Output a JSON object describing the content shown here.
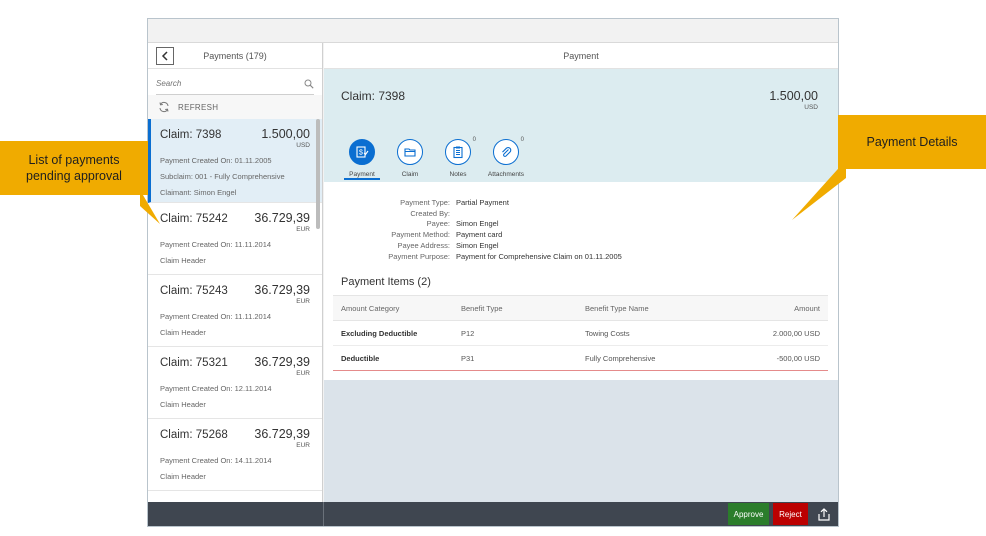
{
  "annotations": {
    "left": "List of payments pending approval",
    "right": "Payment Details"
  },
  "master": {
    "title": "Payments (179)",
    "search_placeholder": "Search",
    "refresh_label": "REFRESH",
    "items": [
      {
        "title": "Claim: 7398",
        "amount": "1.500,00",
        "currency": "USD",
        "attr1": "Payment Created On: 01.11.2005",
        "attr2": "Subclaim: 001 - Fully Comprehensive",
        "attr3": "Claimant: Simon Engel"
      },
      {
        "title": "Claim: 75242",
        "amount": "36.729,39",
        "currency": "EUR",
        "attr1": "Payment Created On: 11.11.2014",
        "attr2": "Claim Header"
      },
      {
        "title": "Claim: 75243",
        "amount": "36.729,39",
        "currency": "EUR",
        "attr1": "Payment Created On: 11.11.2014",
        "attr2": "Claim Header"
      },
      {
        "title": "Claim: 75321",
        "amount": "36.729,39",
        "currency": "EUR",
        "attr1": "Payment Created On: 12.11.2014",
        "attr2": "Claim Header"
      },
      {
        "title": "Claim: 75268",
        "amount": "36.729,39",
        "currency": "EUR",
        "attr1": "Payment Created On: 14.11.2014",
        "attr2": "Claim Header"
      }
    ]
  },
  "detail": {
    "title": "Payment",
    "object_title": "Claim: 7398",
    "object_amount": "1.500,00",
    "object_currency": "USD",
    "tabs": [
      {
        "label": "Payment",
        "icon": "payment-icon",
        "count": ""
      },
      {
        "label": "Claim",
        "icon": "folder-icon",
        "count": ""
      },
      {
        "label": "Notes",
        "icon": "notes-icon",
        "count": "0"
      },
      {
        "label": "Attachments",
        "icon": "paperclip-icon",
        "count": "0"
      }
    ],
    "form": [
      {
        "label": "Payment Type:",
        "value": "Partial Payment"
      },
      {
        "label": "Created By:",
        "value": ""
      },
      {
        "label": "Payee:",
        "value": "Simon Engel"
      },
      {
        "label": "Payment Method:",
        "value": "Payment card"
      },
      {
        "label": "Payee Address:",
        "value": "Simon Engel"
      },
      {
        "label": "Payment Purpose:",
        "value": "Payment for Comprehensive Claim on 01.11.2005"
      }
    ],
    "items_title": "Payment Items (2)",
    "items_columns": [
      "Amount Category",
      "Benefit Type",
      "Benefit Type Name",
      "Amount"
    ],
    "items_rows": [
      [
        "Excluding Deductible",
        "P12",
        "Towing Costs",
        "2.000,00 USD"
      ],
      [
        "Deductible",
        "P31",
        "Fully Comprehensive",
        "-500,00 USD"
      ]
    ]
  },
  "footer": {
    "approve_label": "Approve",
    "reject_label": "Reject"
  },
  "colors": {
    "accent": "#0a6ed1",
    "callout": "#f0ab00",
    "approve": "#2b7d2b",
    "reject": "#bb0000",
    "object_header_bg": "#dcecf0"
  }
}
